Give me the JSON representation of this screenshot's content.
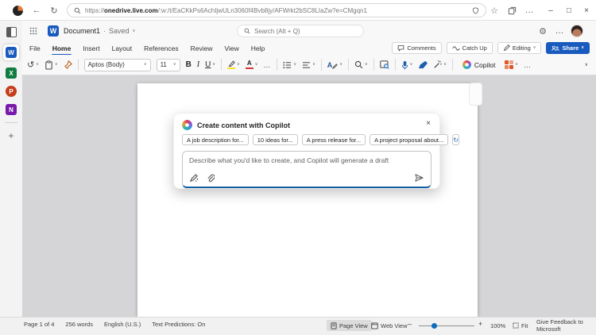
{
  "browser": {
    "url": {
      "scheme": "https://",
      "domain": "onedrive.live.com",
      "path": "/:w:/t/EaCKkPs6AchIjwULn3060f4Bvb8jy/AFWrkt2bSC8LIaZw?e=CMgqn1"
    }
  },
  "glyphs": {
    "back": "←",
    "reload": "↻",
    "ellipsis": "…",
    "minimize": "–",
    "maximize": "□",
    "close": "×",
    "chevron": "∨",
    "undo": "↺",
    "plus": "+",
    "gear": "⚙",
    "star": "☆",
    "refresh": "↻",
    "minus": "–",
    "word_letter": "W",
    "excel_letter": "X",
    "ppt_letter": "P",
    "onenote_letter": "N",
    "bold": "B",
    "italic": "I",
    "underline": "U",
    "letter_a": "A"
  },
  "app_header": {
    "doc_title": "Document1",
    "separator": "·",
    "save_status": "Saved",
    "search_placeholder": "Search (Alt + Q)"
  },
  "menu": {
    "items": [
      "File",
      "Home",
      "Insert",
      "Layout",
      "References",
      "Review",
      "View",
      "Help"
    ],
    "active": "Home"
  },
  "topbar_actions": {
    "comments": "Comments",
    "catch_up": "Catch Up",
    "editing": "Editing",
    "share": "Share"
  },
  "ribbon": {
    "font_name": "Aptos (Body)",
    "font_size": "11",
    "copilot_label": "Copilot"
  },
  "copilot_dialog": {
    "title": "Create content with Copilot",
    "chips": [
      "A job description for...",
      "10 ideas for...",
      "A press release for...",
      "A project proposal about..."
    ],
    "placeholder": "Describe what you'd like to create, and Copilot will generate a draft"
  },
  "status_bar": {
    "page_info": "Page 1 of 4",
    "word_count": "256 words",
    "language": "English (U.S.)",
    "text_predictions": "Text Predictions: On",
    "page_view": "Page View",
    "web_view": "Web View",
    "zoom_level": "100%",
    "fit": "Fit",
    "feedback": "Give Feedback to Microsoft"
  },
  "colors": {
    "accent_blue": "#185abd",
    "copilot_input_accent": "#115ea3",
    "word_blue": "#185abd",
    "excel_green": "#107c41",
    "powerpoint_orange": "#c43e1c",
    "onenote_purple": "#7719aa"
  }
}
